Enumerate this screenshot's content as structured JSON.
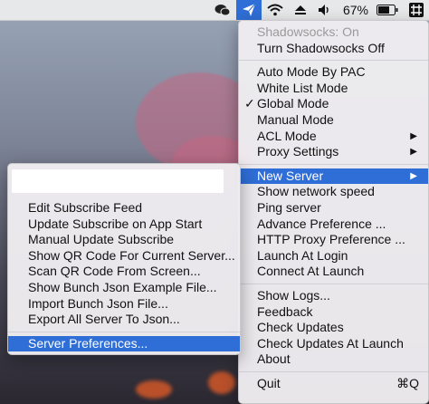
{
  "menubar": {
    "battery_percent": "67%"
  },
  "main_menu": {
    "status": "Shadowsocks: On",
    "toggle": "Turn Shadowsocks Off",
    "modes": [
      "Auto Mode By PAC",
      "White List Mode",
      "Global Mode",
      "Manual Mode",
      "ACL Mode",
      "Proxy Settings"
    ],
    "checked_mode": "Global Mode",
    "server_items": [
      "New Server",
      "Show network speed",
      "Ping server",
      "Advance Preference ...",
      "HTTP Proxy Preference ...",
      "Launch At Login",
      "Connect At Launch"
    ],
    "help_items": [
      "Show Logs...",
      "Feedback",
      "Check Updates",
      "Check Updates At Launch",
      "About"
    ],
    "quit": "Quit",
    "quit_shortcut": "⌘Q",
    "check_glyph": "✓",
    "submenu_arrow": "▶"
  },
  "sub_menu": {
    "search_value": "",
    "items": [
      "Edit Subscribe Feed",
      "Update Subscribe on App Start",
      "Manual Update Subscribe",
      "Show QR Code For Current Server...",
      "Scan QR Code From Screen...",
      "Show Bunch Json Example File...",
      "Import Bunch Json File...",
      "Export All Server To Json..."
    ],
    "preferences": "Server Preferences..."
  },
  "icons": {
    "menubar": [
      "wechat-icon",
      "shadowsocks-plane-icon",
      "wifi-icon",
      "eject-icon",
      "volume-icon",
      "battery-icon",
      "grid-app-icon"
    ]
  },
  "colors": {
    "selection": "#2f6ed6",
    "disabled_text": "#9a9a9a"
  }
}
